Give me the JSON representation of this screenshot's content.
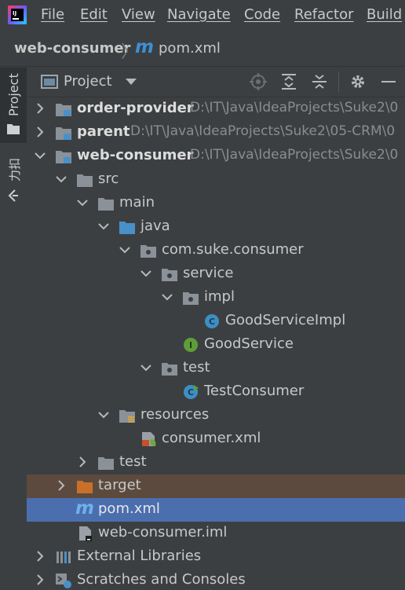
{
  "menu": [
    "File",
    "Edit",
    "View",
    "Navigate",
    "Code",
    "Refactor",
    "Build"
  ],
  "breadcrumb": {
    "root": "web-consumer",
    "file": "pom.xml"
  },
  "toolstrip": {
    "project": "Project",
    "favorites": "力扣"
  },
  "panel": {
    "title": "Project"
  },
  "tree": {
    "order_provider": {
      "name": "order-provider",
      "path": "D:\\IT\\Java\\IdeaProjects\\Suke2\\0"
    },
    "parent": {
      "name": "parent",
      "path": "D:\\IT\\Java\\IdeaProjects\\Suke2\\05-CRM\\0"
    },
    "web_consumer": {
      "name": "web-consumer",
      "path": "D:\\IT\\Java\\IdeaProjects\\Suke2\\0"
    },
    "src": "src",
    "main": "main",
    "java": "java",
    "package": "com.suke.consumer",
    "service": "service",
    "impl": "impl",
    "good_service_impl": "GoodServiceImpl",
    "good_service": "GoodService",
    "test_pkg": "test",
    "test_consumer": "TestConsumer",
    "resources": "resources",
    "consumer_xml": "consumer.xml",
    "test_dir": "test",
    "target": "target",
    "pom": "pom.xml",
    "iml": "web-consumer.iml",
    "external_libraries": "External Libraries",
    "scratches": "Scratches and Consoles"
  },
  "colors": {
    "selection": "#4b6eaf",
    "folder": "#8a9199",
    "source_folder": "#4a90c8",
    "target_folder": "#c8702a",
    "class_icon": "#3c8fc4",
    "interface_icon": "#5e9e3a"
  }
}
